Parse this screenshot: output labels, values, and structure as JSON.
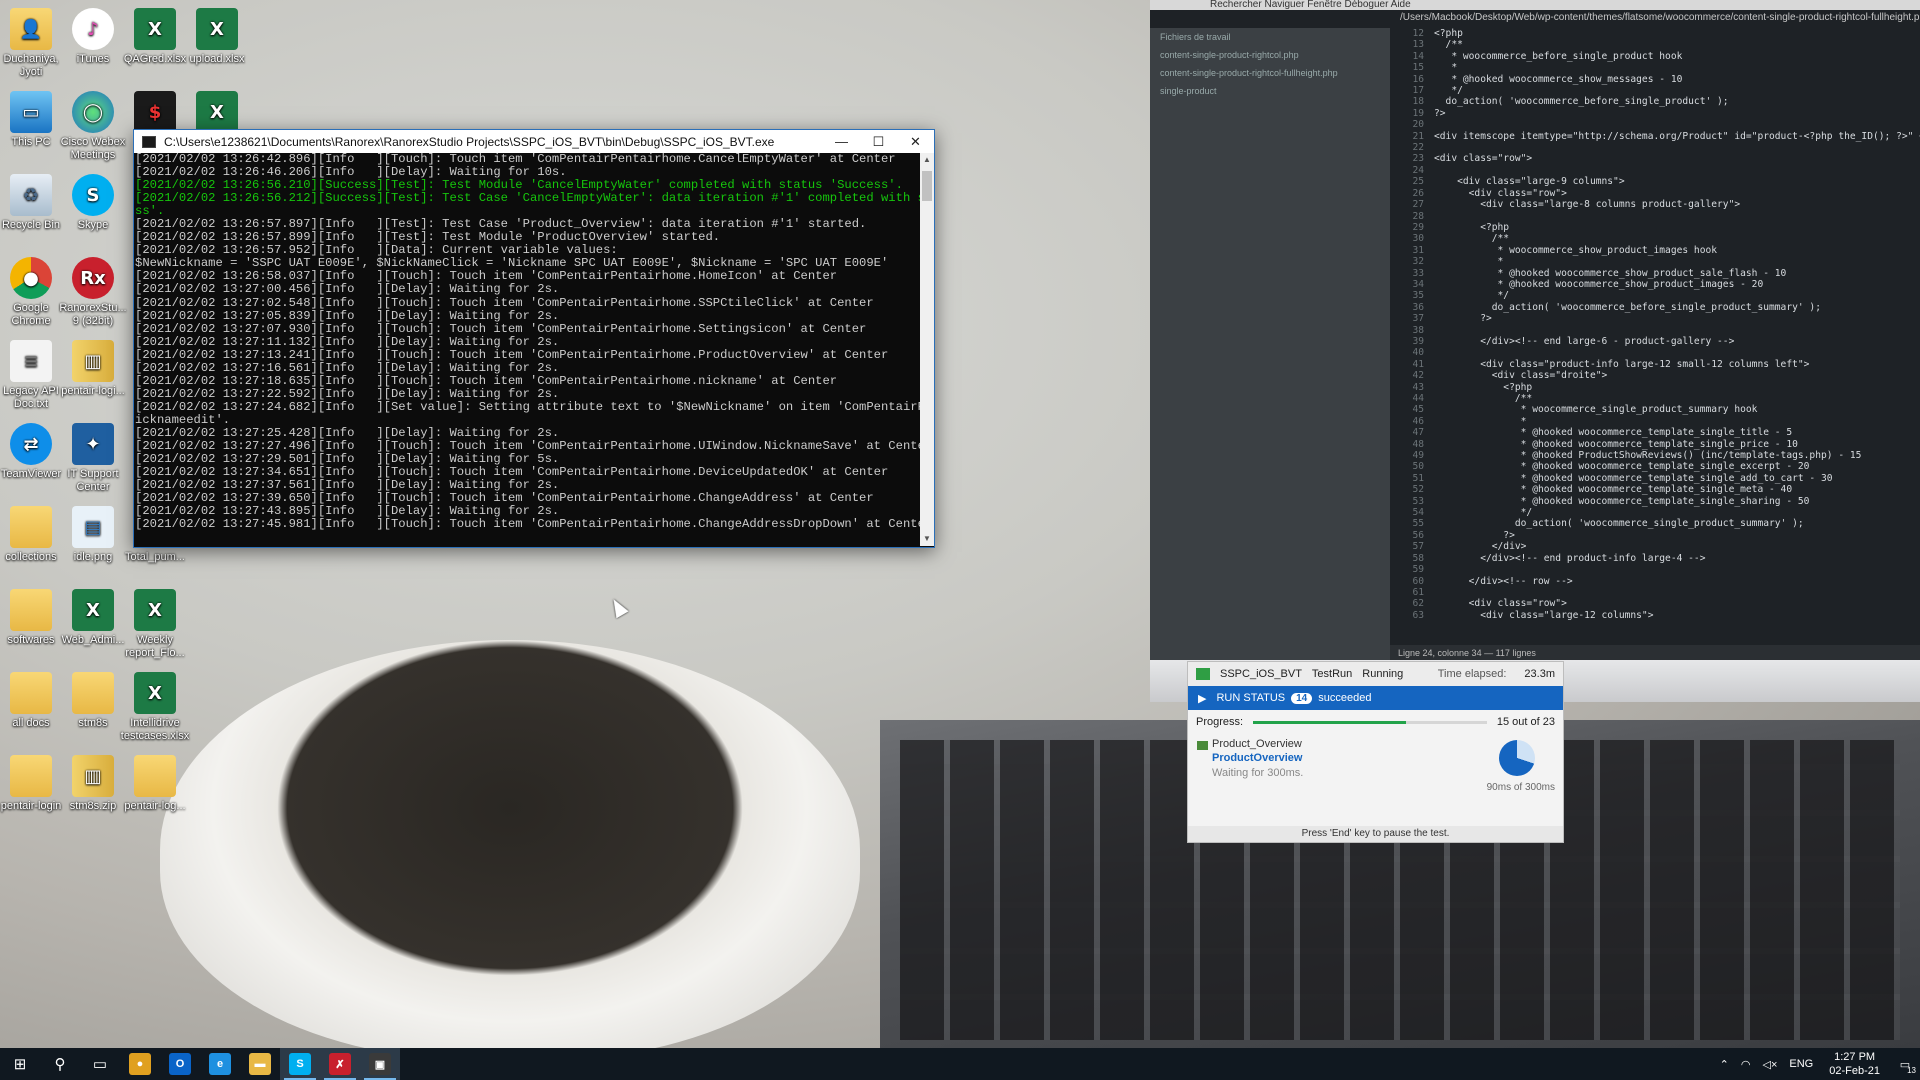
{
  "desktop": {
    "icons": [
      {
        "label": "Duchaniya, Jyoti",
        "icon": "user-folder-icon"
      },
      {
        "label": "iTunes",
        "icon": "itunes-icon"
      },
      {
        "label": "QAGred.xlsx",
        "icon": "excel-icon"
      },
      {
        "label": "upload.xlsx",
        "icon": "excel-icon"
      },
      {
        "label": "This PC",
        "icon": "computer-icon"
      },
      {
        "label": "Cisco Webex Meetings",
        "icon": "webex-icon"
      },
      {
        "label": "",
        "icon": "terminal-icon"
      },
      {
        "label": "",
        "icon": "excel-icon"
      },
      {
        "label": "Recycle Bin",
        "icon": "recycle-bin-icon"
      },
      {
        "label": "Skype",
        "icon": "skype-icon"
      },
      {
        "label": "Google Chrome",
        "icon": "chrome-icon"
      },
      {
        "label": "RanorexStu... 9 (32bit)",
        "icon": "ranorex-icon"
      },
      {
        "label": "Legacy API Doc.txt",
        "icon": "text-file-icon"
      },
      {
        "label": "pentair-logi...",
        "icon": "zip-icon"
      },
      {
        "label": "TeamViewer",
        "icon": "teamviewer-icon"
      },
      {
        "label": "IT Support Center",
        "icon": "it-support-icon"
      },
      {
        "label": "collections",
        "icon": "folder-icon"
      },
      {
        "label": "idle.png",
        "icon": "image-icon"
      },
      {
        "label": "Total_pum...",
        "icon": "file-icon"
      },
      {
        "label": "softwares",
        "icon": "folder-icon"
      },
      {
        "label": "Web_Admi...",
        "icon": "excel-icon"
      },
      {
        "label": "Weekly report_Flo...",
        "icon": "excel-icon"
      },
      {
        "label": "all docs",
        "icon": "folder-icon"
      },
      {
        "label": "stm8s",
        "icon": "folder-icon"
      },
      {
        "label": "Intellidrive testcases.xlsx",
        "icon": "excel-icon"
      },
      {
        "label": "pentair-login",
        "icon": "folder-icon"
      },
      {
        "label": "stm8s.zip",
        "icon": "zip-icon"
      },
      {
        "label": "pentair-log...",
        "icon": "folder-icon"
      }
    ]
  },
  "wallpaper": {
    "menubar": "Rechercher   Naviguer   Fenêtre   Déboguer   Aide",
    "path": "/Users/Macbook/Desktop/Web/wp-content/themes/flatsome/woocommerce/content-single-product-rightcol-fullheight.php (single-product) — Brackets",
    "sidebar_title": "Fichiers de travail",
    "sidebar_files": [
      "content-single-product-rightcol.php",
      "content-single-product-rightcol-fullheight.php"
    ],
    "sidebar_folder": "single-product",
    "status": "Ligne 24, colonne 34 — 117 lignes",
    "code_lines": [
      {
        "n": "12",
        "t": "<?php"
      },
      {
        "n": "13",
        "t": "  /**"
      },
      {
        "n": "14",
        "t": "   * woocommerce_before_single_product hook"
      },
      {
        "n": "15",
        "t": "   *"
      },
      {
        "n": "16",
        "t": "   * @hooked woocommerce_show_messages - 10"
      },
      {
        "n": "17",
        "t": "   */"
      },
      {
        "n": "18",
        "t": "  do_action( 'woocommerce_before_single_product' );"
      },
      {
        "n": "19",
        "t": "?>"
      },
      {
        "n": "20",
        "t": ""
      },
      {
        "n": "21",
        "t": "<div itemscope itemtype=\"http://schema.org/Product\" id=\"product-<?php the_ID(); ?>\" <?php post_class(); ?>>"
      },
      {
        "n": "22",
        "t": ""
      },
      {
        "n": "23",
        "t": "<div class=\"row\">"
      },
      {
        "n": "24",
        "t": ""
      },
      {
        "n": "25",
        "t": "    <div class=\"large-9 columns\">"
      },
      {
        "n": "26",
        "t": "      <div class=\"row\">"
      },
      {
        "n": "27",
        "t": "        <div class=\"large-8 columns product-gallery\">"
      },
      {
        "n": "28",
        "t": ""
      },
      {
        "n": "29",
        "t": "        <?php"
      },
      {
        "n": "30",
        "t": "          /**"
      },
      {
        "n": "31",
        "t": "           * woocommerce_show_product_images hook"
      },
      {
        "n": "32",
        "t": "           *"
      },
      {
        "n": "33",
        "t": "           * @hooked woocommerce_show_product_sale_flash - 10"
      },
      {
        "n": "34",
        "t": "           * @hooked woocommerce_show_product_images - 20"
      },
      {
        "n": "35",
        "t": "           */"
      },
      {
        "n": "36",
        "t": "          do_action( 'woocommerce_before_single_product_summary' );"
      },
      {
        "n": "37",
        "t": "        ?>"
      },
      {
        "n": "38",
        "t": ""
      },
      {
        "n": "39",
        "t": "        </div><!-- end large-6 - product-gallery -->"
      },
      {
        "n": "40",
        "t": ""
      },
      {
        "n": "41",
        "t": "        <div class=\"product-info large-12 small-12 columns left\">"
      },
      {
        "n": "42",
        "t": "          <div class=\"droite\">"
      },
      {
        "n": "43",
        "t": "            <?php"
      },
      {
        "n": "44",
        "t": "              /**"
      },
      {
        "n": "45",
        "t": "               * woocommerce_single_product_summary hook"
      },
      {
        "n": "46",
        "t": "               *"
      },
      {
        "n": "47",
        "t": "               * @hooked woocommerce_template_single_title - 5"
      },
      {
        "n": "48",
        "t": "               * @hooked woocommerce_template_single_price - 10"
      },
      {
        "n": "49",
        "t": "               * @hooked ProductShowReviews() (inc/template-tags.php) - 15"
      },
      {
        "n": "50",
        "t": "               * @hooked woocommerce_template_single_excerpt - 20"
      },
      {
        "n": "51",
        "t": "               * @hooked woocommerce_template_single_add_to_cart - 30"
      },
      {
        "n": "52",
        "t": "               * @hooked woocommerce_template_single_meta - 40"
      },
      {
        "n": "53",
        "t": "               * @hooked woocommerce_template_single_sharing - 50"
      },
      {
        "n": "54",
        "t": "               */"
      },
      {
        "n": "55",
        "t": "              do_action( 'woocommerce_single_product_summary' );"
      },
      {
        "n": "56",
        "t": "            ?>"
      },
      {
        "n": "57",
        "t": "          </div>"
      },
      {
        "n": "58",
        "t": "        </div><!-- end product-info large-4 -->"
      },
      {
        "n": "59",
        "t": ""
      },
      {
        "n": "60",
        "t": "      </div><!-- row -->"
      },
      {
        "n": "61",
        "t": ""
      },
      {
        "n": "62",
        "t": "      <div class=\"row\">"
      },
      {
        "n": "63",
        "t": "        <div class=\"large-12 columns\">"
      }
    ]
  },
  "console": {
    "title": "C:\\Users\\e1238621\\Documents\\Ranorex\\RanorexStudio Projects\\SSPC_iOS_BVT\\bin\\Debug\\SSPC_iOS_BVT.exe",
    "minimize": "—",
    "maximize": "☐",
    "close": "✕",
    "lines": [
      {
        "t": "[2021/02/02 13:26:42.896][Info   ][Touch]: Touch item 'ComPentairPentairhome.CancelEmptyWater' at Center",
        "s": false
      },
      {
        "t": "[2021/02/02 13:26:46.206][Info   ][Delay]: Waiting for 10s.",
        "s": false
      },
      {
        "t": "[2021/02/02 13:26:56.210][Success][Test]: Test Module 'CancelEmptyWater' completed with status 'Success'.",
        "s": true
      },
      {
        "t": "[2021/02/02 13:26:56.212][Success][Test]: Test Case 'CancelEmptyWater': data iteration #'1' completed with status 'Succe",
        "s": true
      },
      {
        "t": "ss'.",
        "s": true
      },
      {
        "t": "[2021/02/02 13:26:57.897][Info   ][Test]: Test Case 'Product_Overview': data iteration #'1' started.",
        "s": false
      },
      {
        "t": "[2021/02/02 13:26:57.899][Info   ][Test]: Test Module 'ProductOverview' started.",
        "s": false
      },
      {
        "t": "[2021/02/02 13:26:57.952][Info   ][Data]: Current variable values:",
        "s": false
      },
      {
        "t": "$NewNickname = 'SSPC UAT E009E', $NickNameClick = 'Nickname SPC UAT E009E', $Nickname = 'SPC UAT E009E'",
        "s": false
      },
      {
        "t": "[2021/02/02 13:26:58.037][Info   ][Touch]: Touch item 'ComPentairPentairhome.HomeIcon' at Center",
        "s": false
      },
      {
        "t": "[2021/02/02 13:27:00.456][Info   ][Delay]: Waiting for 2s.",
        "s": false
      },
      {
        "t": "[2021/02/02 13:27:02.548][Info   ][Touch]: Touch item 'ComPentairPentairhome.SSPCtileClick' at Center",
        "s": false
      },
      {
        "t": "[2021/02/02 13:27:05.839][Info   ][Delay]: Waiting for 2s.",
        "s": false
      },
      {
        "t": "[2021/02/02 13:27:07.930][Info   ][Touch]: Touch item 'ComPentairPentairhome.Settingsicon' at Center",
        "s": false
      },
      {
        "t": "[2021/02/02 13:27:11.132][Info   ][Delay]: Waiting for 2s.",
        "s": false
      },
      {
        "t": "[2021/02/02 13:27:13.241][Info   ][Touch]: Touch item 'ComPentairPentairhome.ProductOverview' at Center",
        "s": false
      },
      {
        "t": "[2021/02/02 13:27:16.561][Info   ][Delay]: Waiting for 2s.",
        "s": false
      },
      {
        "t": "[2021/02/02 13:27:18.635][Info   ][Touch]: Touch item 'ComPentairPentairhome.nickname' at Center",
        "s": false
      },
      {
        "t": "[2021/02/02 13:27:22.592][Info   ][Delay]: Waiting for 2s.",
        "s": false
      },
      {
        "t": "[2021/02/02 13:27:24.682][Info   ][Set value]: Setting attribute text to '$NewNickname' on item 'ComPentairPentairhome.n",
        "s": false
      },
      {
        "t": "icknameedit'.",
        "s": false
      },
      {
        "t": "[2021/02/02 13:27:25.428][Info   ][Delay]: Waiting for 2s.",
        "s": false
      },
      {
        "t": "[2021/02/02 13:27:27.496][Info   ][Touch]: Touch item 'ComPentairPentairhome.UIWindow.NicknameSave' at Center",
        "s": false
      },
      {
        "t": "[2021/02/02 13:27:29.501][Info   ][Delay]: Waiting for 5s.",
        "s": false
      },
      {
        "t": "[2021/02/02 13:27:34.651][Info   ][Touch]: Touch item 'ComPentairPentairhome.DeviceUpdatedOK' at Center",
        "s": false
      },
      {
        "t": "[2021/02/02 13:27:37.561][Info   ][Delay]: Waiting for 2s.",
        "s": false
      },
      {
        "t": "[2021/02/02 13:27:39.650][Info   ][Touch]: Touch item 'ComPentairPentairhome.ChangeAddress' at Center",
        "s": false
      },
      {
        "t": "[2021/02/02 13:27:43.895][Info   ][Delay]: Waiting for 2s.",
        "s": false
      },
      {
        "t": "[2021/02/02 13:27:45.981][Info   ][Touch]: Touch item 'ComPentairPentairhome.ChangeAddressDropDown' at Center",
        "s": false
      }
    ]
  },
  "ranorex": {
    "project": "SSPC_iOS_BVT",
    "run_type": "TestRun",
    "state": "Running",
    "time_elapsed_label": "Time elapsed:",
    "time_elapsed": "23.3m",
    "run_status_label": "RUN STATUS",
    "succeeded_count": "14",
    "succeeded_label": "succeeded",
    "progress_label": "Progress:",
    "progress_text": "15 out of 23",
    "progress_fraction": 0.652,
    "test_case": "Product_Overview",
    "module": "ProductOverview",
    "module_status": "Waiting for 300ms.",
    "delay_text": "90ms of 300ms",
    "delay_fraction": 0.3,
    "footer": "Press 'End' key to pause the test.",
    "accent_color": "#1565c0"
  },
  "taskbar": {
    "apps": [
      {
        "name": "start-button",
        "glyph": "⊞",
        "active": false
      },
      {
        "name": "search-button",
        "glyph": "⚲",
        "active": false
      },
      {
        "name": "task-view-button",
        "glyph": "▭",
        "active": false
      },
      {
        "name": "chrome",
        "glyph": "●",
        "active": false
      },
      {
        "name": "outlook",
        "glyph": "O",
        "active": false
      },
      {
        "name": "internet-explorer",
        "glyph": "e",
        "active": false
      },
      {
        "name": "file-explorer",
        "glyph": "▬",
        "active": false
      },
      {
        "name": "skype",
        "glyph": "S",
        "active": true
      },
      {
        "name": "ranorex",
        "glyph": "✗",
        "active": true
      },
      {
        "name": "console",
        "glyph": "▣",
        "active": true
      }
    ],
    "language": "ENG",
    "time": "1:27 PM",
    "date": "02-Feb-21",
    "notifications": "13"
  }
}
